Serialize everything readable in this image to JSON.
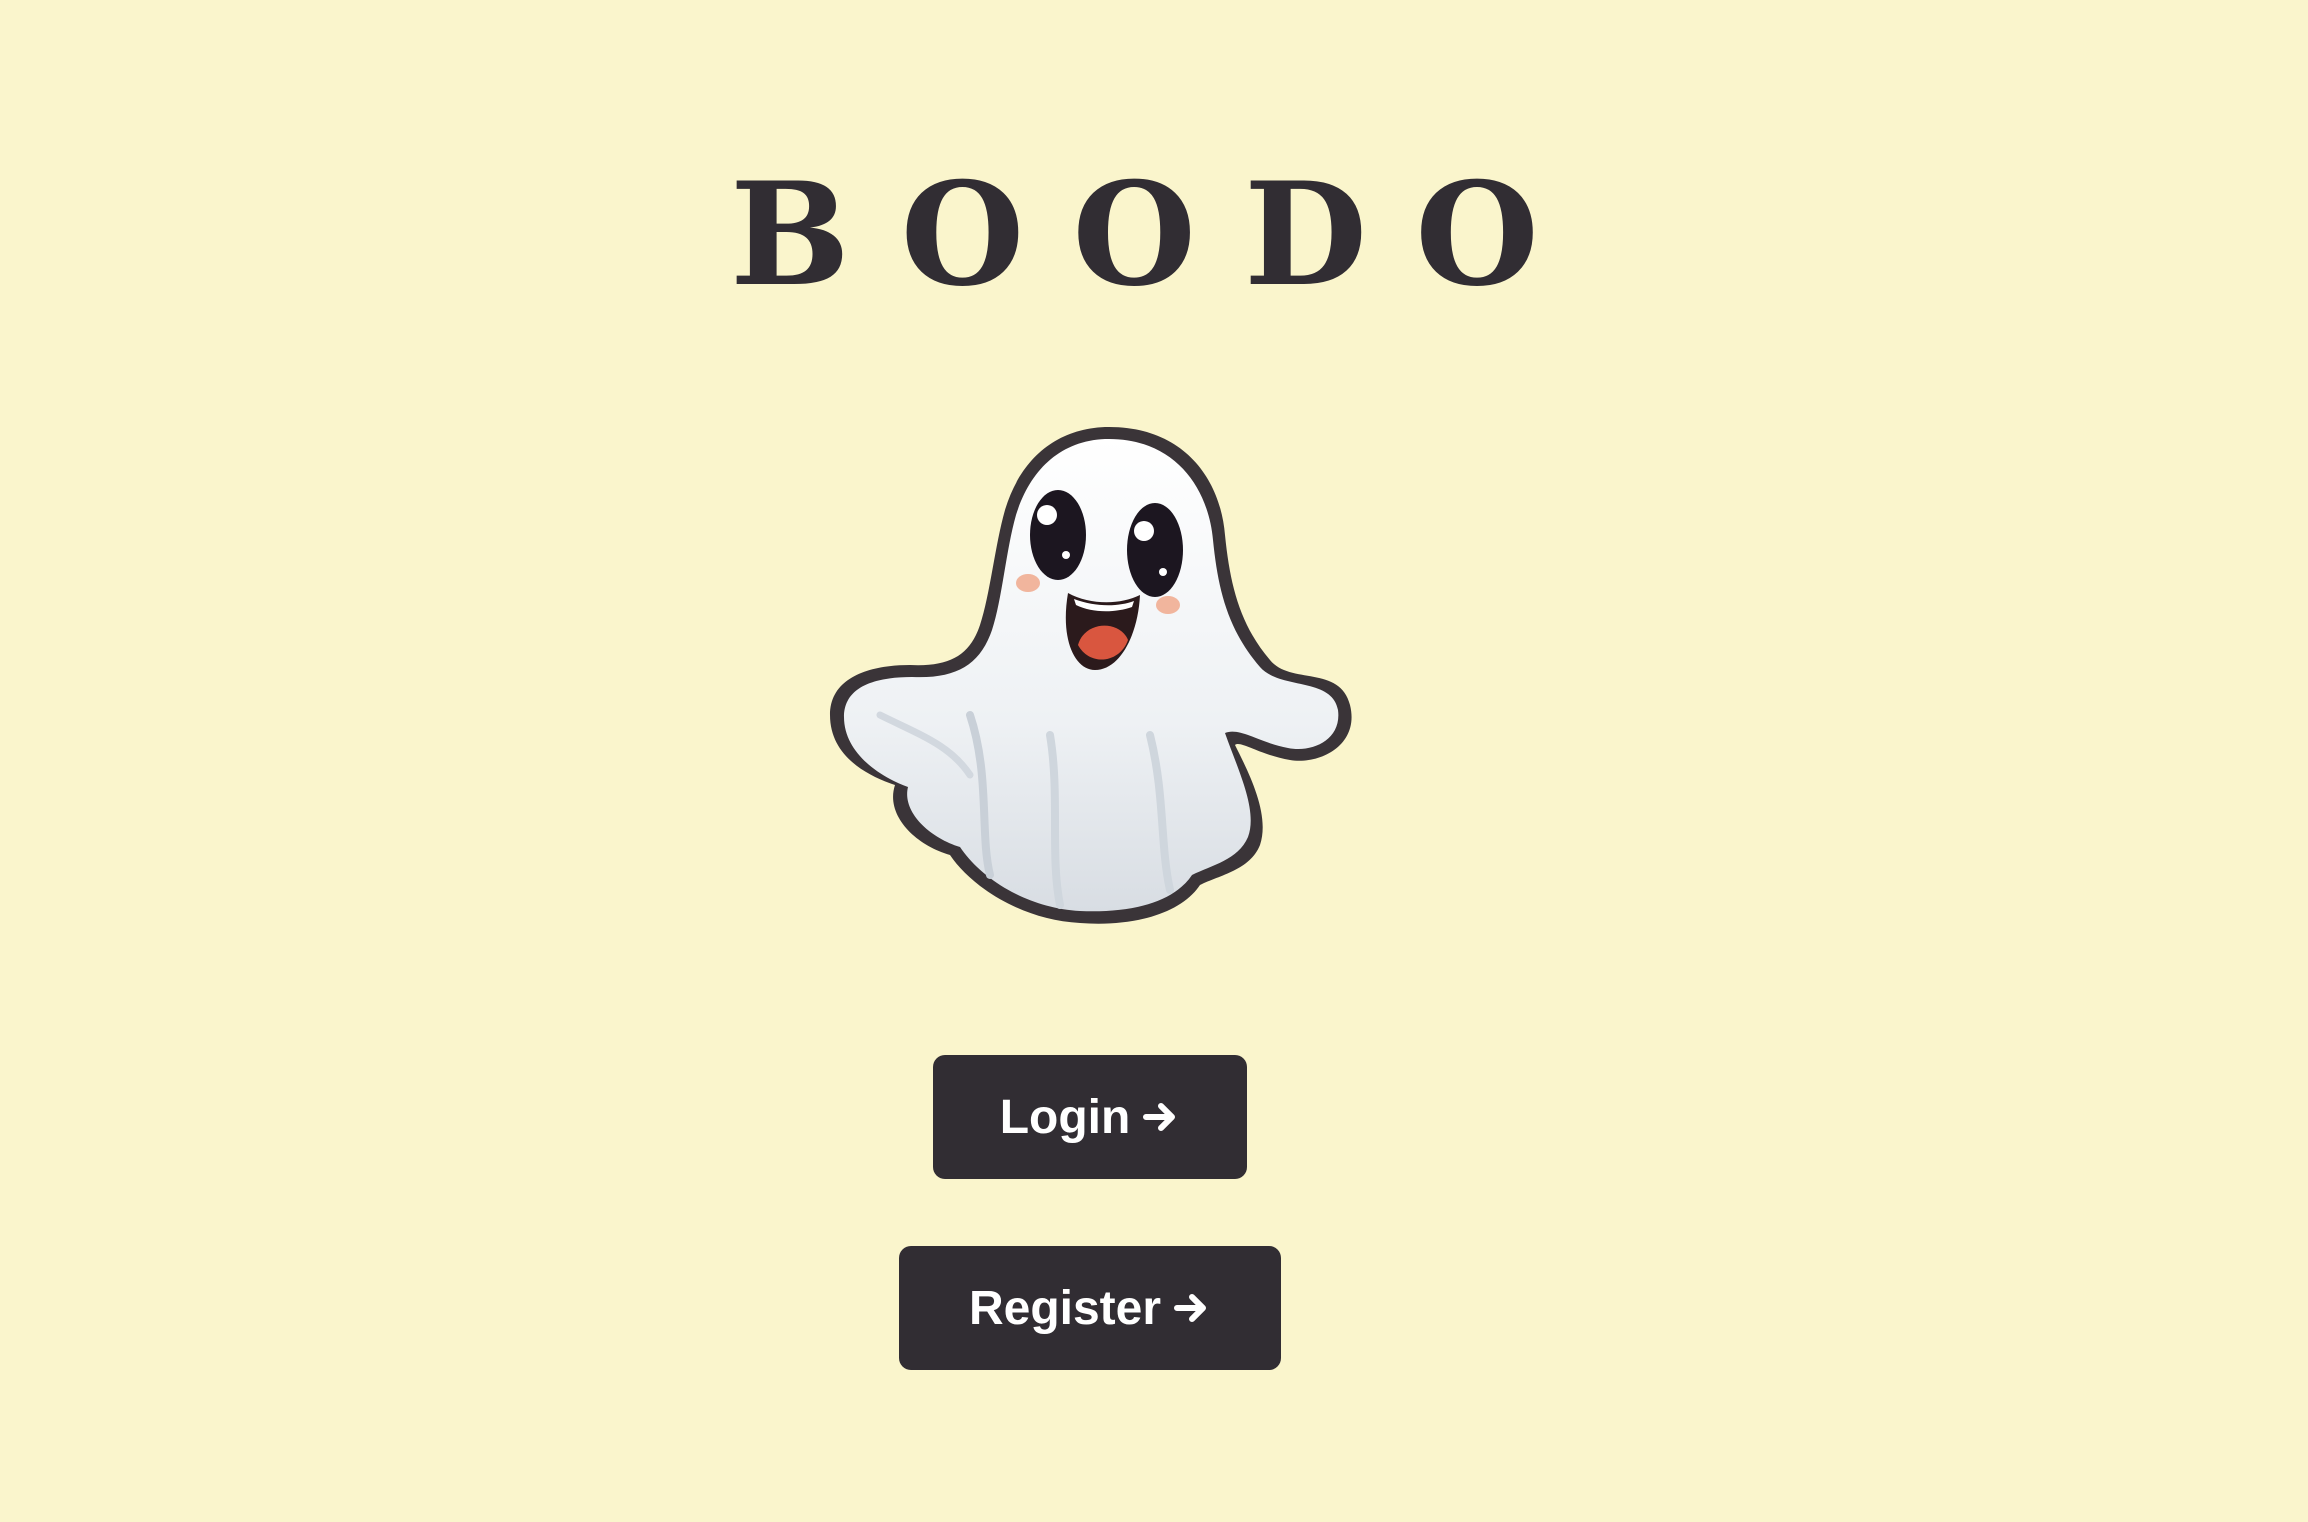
{
  "app": {
    "title": "BOODO"
  },
  "colors": {
    "background": "#FAF5CC",
    "primary": "#312D33",
    "button_text": "#FFFFFF"
  },
  "mascot": {
    "icon": "ghost-icon"
  },
  "actions": {
    "login_label": "Login",
    "register_label": "Register",
    "arrow_icon": "arrow-right-icon"
  }
}
